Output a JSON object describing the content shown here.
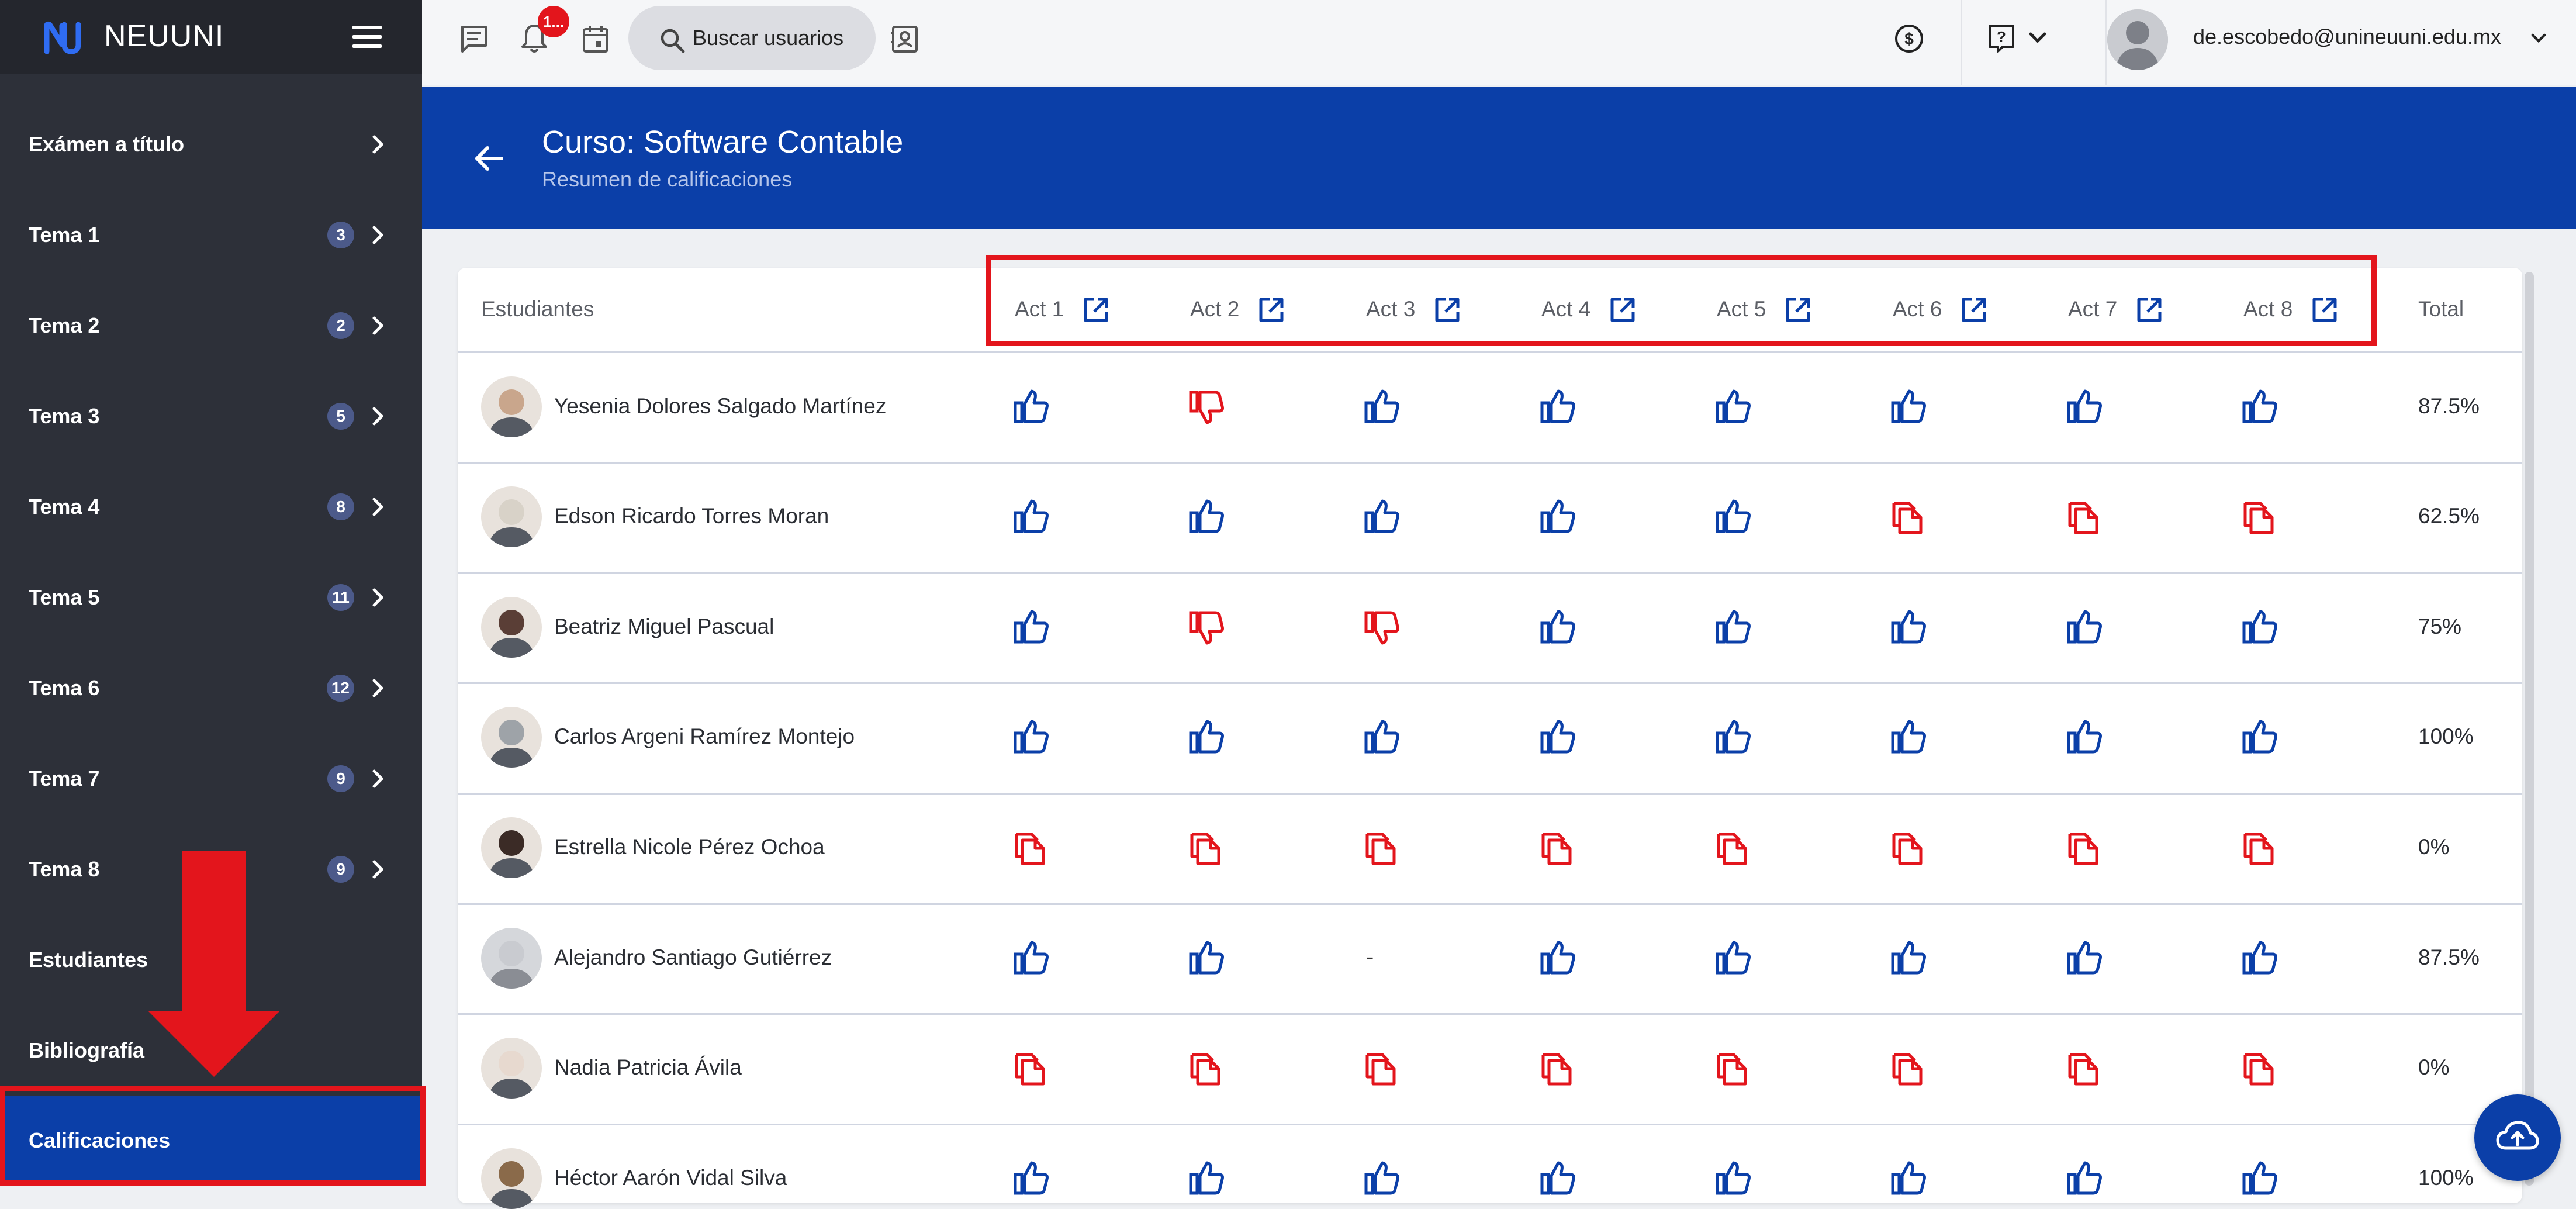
{
  "brand": {
    "name": "NEUUNI"
  },
  "sidebar": {
    "items": [
      {
        "label": "Exámen a título",
        "badge": ""
      },
      {
        "label": "Tema 1",
        "badge": "3"
      },
      {
        "label": "Tema 2",
        "badge": "2"
      },
      {
        "label": "Tema 3",
        "badge": "5"
      },
      {
        "label": "Tema 4",
        "badge": "8"
      },
      {
        "label": "Tema 5",
        "badge": "11"
      },
      {
        "label": "Tema 6",
        "badge": "12"
      },
      {
        "label": "Tema 7",
        "badge": "9"
      },
      {
        "label": "Tema 8",
        "badge": "9"
      },
      {
        "label": "Estudiantes",
        "badge": ""
      },
      {
        "label": "Bibliografía",
        "badge": ""
      },
      {
        "label": "Calificaciones",
        "badge": "",
        "active": true
      }
    ]
  },
  "topbar": {
    "notif_badge": "1...",
    "search_label": "Buscar usuarios",
    "user_email": "de.escobedo@unineuuni.edu.mx"
  },
  "header": {
    "title": "Curso: Software Contable",
    "subtitle": "Resumen de calificaciones"
  },
  "table": {
    "student_col": "Estudiantes",
    "total_col": "Total",
    "activities": [
      "Act 1",
      "Act 2",
      "Act 3",
      "Act 4",
      "Act 5",
      "Act 6",
      "Act 7",
      "Act 8"
    ],
    "rows": [
      {
        "name": "Yesenia Dolores Salgado Martínez",
        "cells": [
          "up",
          "down",
          "up",
          "up",
          "up",
          "up",
          "up",
          "up"
        ],
        "total": "87.5%"
      },
      {
        "name": "Edson Ricardo Torres Moran",
        "cells": [
          "up",
          "up",
          "up",
          "up",
          "up",
          "missing",
          "missing",
          "missing"
        ],
        "total": "62.5%"
      },
      {
        "name": "Beatriz Miguel Pascual",
        "cells": [
          "up",
          "down",
          "down",
          "up",
          "up",
          "up",
          "up",
          "up"
        ],
        "total": "75%"
      },
      {
        "name": "Carlos Argeni Ramírez Montejo",
        "cells": [
          "up",
          "up",
          "up",
          "up",
          "up",
          "up",
          "up",
          "up"
        ],
        "total": "100%"
      },
      {
        "name": "Estrella Nicole Pérez Ochoa",
        "cells": [
          "missing",
          "missing",
          "missing",
          "missing",
          "missing",
          "missing",
          "missing",
          "missing"
        ],
        "total": "0%"
      },
      {
        "name": "Alejandro Santiago Gutiérrez",
        "cells": [
          "up",
          "up",
          "-",
          "up",
          "up",
          "up",
          "up",
          "up"
        ],
        "total": "87.5%"
      },
      {
        "name": "Nadia Patricia Ávila",
        "cells": [
          "missing",
          "missing",
          "missing",
          "missing",
          "missing",
          "missing",
          "missing",
          "missing"
        ],
        "total": "0%"
      },
      {
        "name": "Héctor Aarón Vidal Silva",
        "cells": [
          "up",
          "up",
          "up",
          "up",
          "up",
          "up",
          "up",
          "up"
        ],
        "total": "100%"
      }
    ]
  },
  "colors": {
    "primary": "#0b3fa8",
    "sidebar": "#2d3039",
    "alert": "#e3151c",
    "badge": "#4c5a8a"
  }
}
